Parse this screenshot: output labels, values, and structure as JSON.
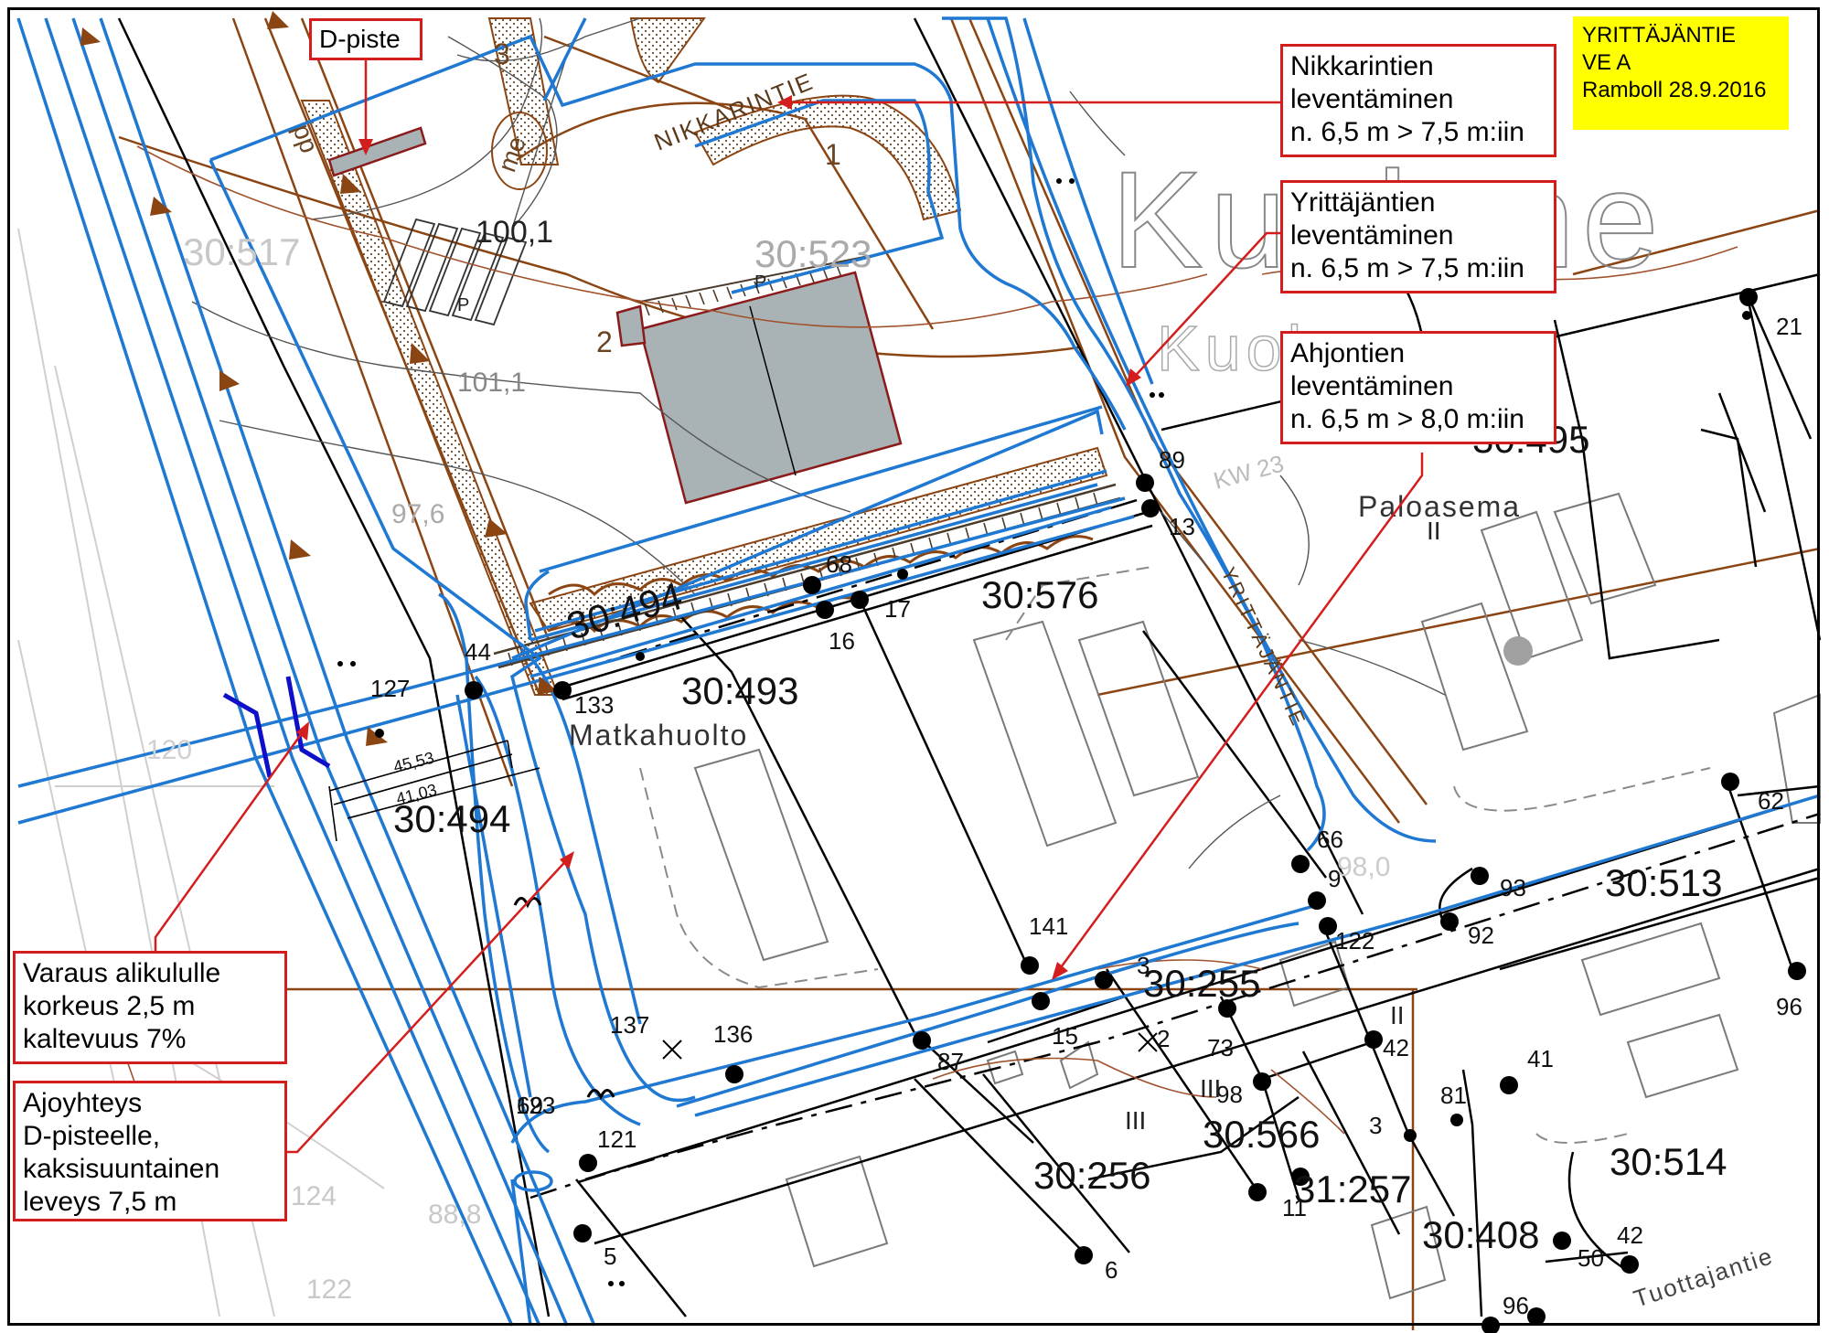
{
  "title_box": {
    "lines": [
      "YRITTÄJÄNTIE",
      "VE A",
      "Ramboll 28.9.2016"
    ],
    "background": "#ffff00"
  },
  "colors": {
    "proposal_blue": "#1f78d1",
    "plan_brown": "#8b4513",
    "callout_red": "#d41e1e",
    "building_gray": "#a9b2b4",
    "underpass_navy": "#1010c8"
  },
  "callouts": {
    "d_piste": "D-piste",
    "nikkarintie": [
      "Nikkarintien",
      "leventäminen",
      "n. 6,5 m > 7,5 m:iin"
    ],
    "yrittajantie": [
      "Yrittäjäntien",
      "leventäminen",
      "n. 6,5 m > 7,5 m:iin"
    ],
    "ahjontie": [
      "Ahjontien",
      "leventäminen",
      "n. 6,5 m > 8,0 m:iin"
    ],
    "alikulku": [
      "Varaus alikululle",
      "korkeus 2,5 m",
      "kaltevuus 7%"
    ],
    "ajoyhteys": [
      "Ajoyhteys",
      "D-pisteelle,",
      "kaksisuuntainen",
      "leveys 7,5 m"
    ]
  },
  "map_labels": {
    "big_name_1": "Kuulane",
    "big_name_2": "Kuoh",
    "paloasema": "Paloasema",
    "matkahuolto": "Matkahuolto",
    "nikkarintie_road": "NIKKARINTIE",
    "yrittajantie_road": "YRITTÄJÄNTIE",
    "tuottajantie_road": "Tuottajantie",
    "kw": "KW 23"
  },
  "parcels": [
    "30:517",
    "30:523",
    "30:494",
    "30:493",
    "30:576",
    "30:495",
    "30:494",
    "30:513",
    "30:255",
    "30:566",
    "30:256",
    "31:257",
    "30:514",
    "30:408"
  ],
  "point_numbers": [
    "21",
    "89",
    "13",
    "68",
    "17",
    "16",
    "44",
    "133",
    "127",
    "66",
    "9",
    "122",
    "62",
    "93",
    "92",
    "141",
    "3",
    "2",
    "73",
    "42",
    "98",
    "87",
    "15",
    "136",
    "137",
    "123",
    "69",
    "121",
    "5",
    "6",
    "11",
    "3",
    "81",
    "41",
    "96",
    "42",
    "50",
    "96"
  ],
  "elevations": [
    "100,1",
    "101,1",
    "97,6",
    "98,0",
    "88,8",
    "124",
    "122",
    "120"
  ],
  "dimensions": [
    "45,53",
    "41,03"
  ],
  "plan_marks": [
    "me",
    "pp",
    "P",
    "P",
    "1",
    "2",
    "3",
    "III",
    "III",
    "II",
    "II"
  ]
}
